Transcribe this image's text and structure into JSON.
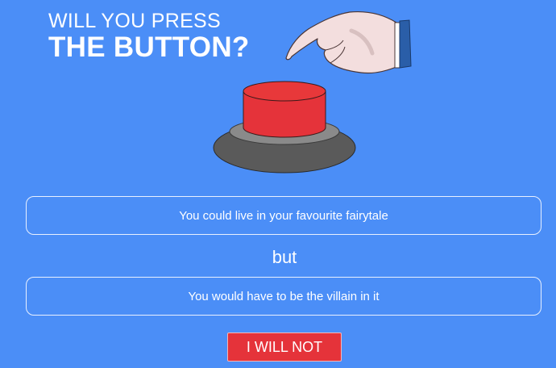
{
  "header": {
    "line1": "WILL YOU PRESS",
    "line2": "THE BUTTON?"
  },
  "dilemma": {
    "option_a": "You could live in your favourite fairytale",
    "separator": "but",
    "option_b": "You would have to be the villain in it"
  },
  "actions": {
    "decline_label": "I WILL NOT"
  },
  "colors": {
    "background": "#4b8ef7",
    "button_red": "#e5333a",
    "text": "#ffffff"
  },
  "icons": {
    "hand": "pointing-hand-icon",
    "button": "red-push-button-icon"
  }
}
